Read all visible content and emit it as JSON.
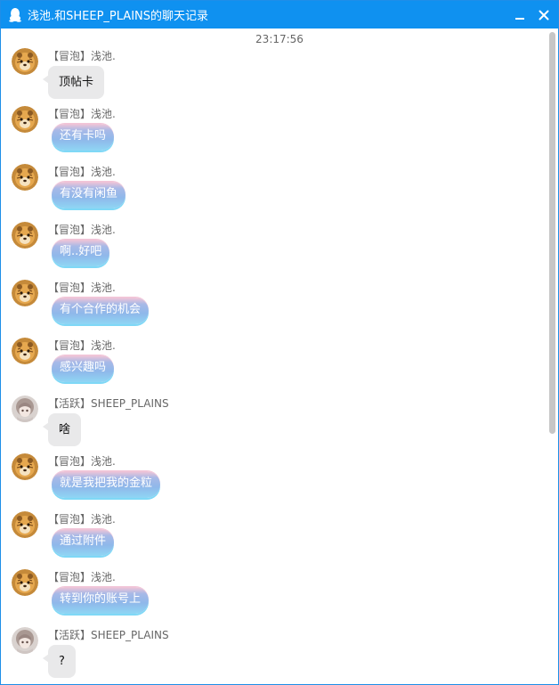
{
  "window": {
    "title": "浅池.和SHEEP_PLAINS的聊天记录",
    "minimize_icon": "minimize-icon",
    "close_icon": "close-icon",
    "title_bar_color": "#0f91f0"
  },
  "timestamp": "23:17:56",
  "messages": [
    {
      "sender": "【冒泡】浅池.",
      "text": "顶帖卡",
      "style": "plain",
      "avatar": "tiger"
    },
    {
      "sender": "【冒泡】浅池.",
      "text": "还有卡吗",
      "style": "fancy",
      "avatar": "tiger"
    },
    {
      "sender": "【冒泡】浅池.",
      "text": "有没有闲鱼",
      "style": "fancy",
      "avatar": "tiger"
    },
    {
      "sender": "【冒泡】浅池.",
      "text": "啊..好吧",
      "style": "fancy",
      "avatar": "tiger"
    },
    {
      "sender": "【冒泡】浅池.",
      "text": "有个合作的机会",
      "style": "fancy",
      "avatar": "tiger"
    },
    {
      "sender": "【冒泡】浅池.",
      "text": "感兴趣吗",
      "style": "fancy",
      "avatar": "tiger"
    },
    {
      "sender": "【活跃】SHEEP_PLAINS",
      "text": "啥",
      "style": "plain",
      "avatar": "girl"
    },
    {
      "sender": "【冒泡】浅池.",
      "text": "就是我把我的金粒",
      "style": "fancy",
      "avatar": "tiger"
    },
    {
      "sender": "【冒泡】浅池.",
      "text": "通过附件",
      "style": "fancy",
      "avatar": "tiger"
    },
    {
      "sender": "【冒泡】浅池.",
      "text": "转到你的账号上",
      "style": "fancy",
      "avatar": "tiger"
    },
    {
      "sender": "【活跃】SHEEP_PLAINS",
      "text": "?",
      "style": "plain",
      "avatar": "girl"
    }
  ]
}
